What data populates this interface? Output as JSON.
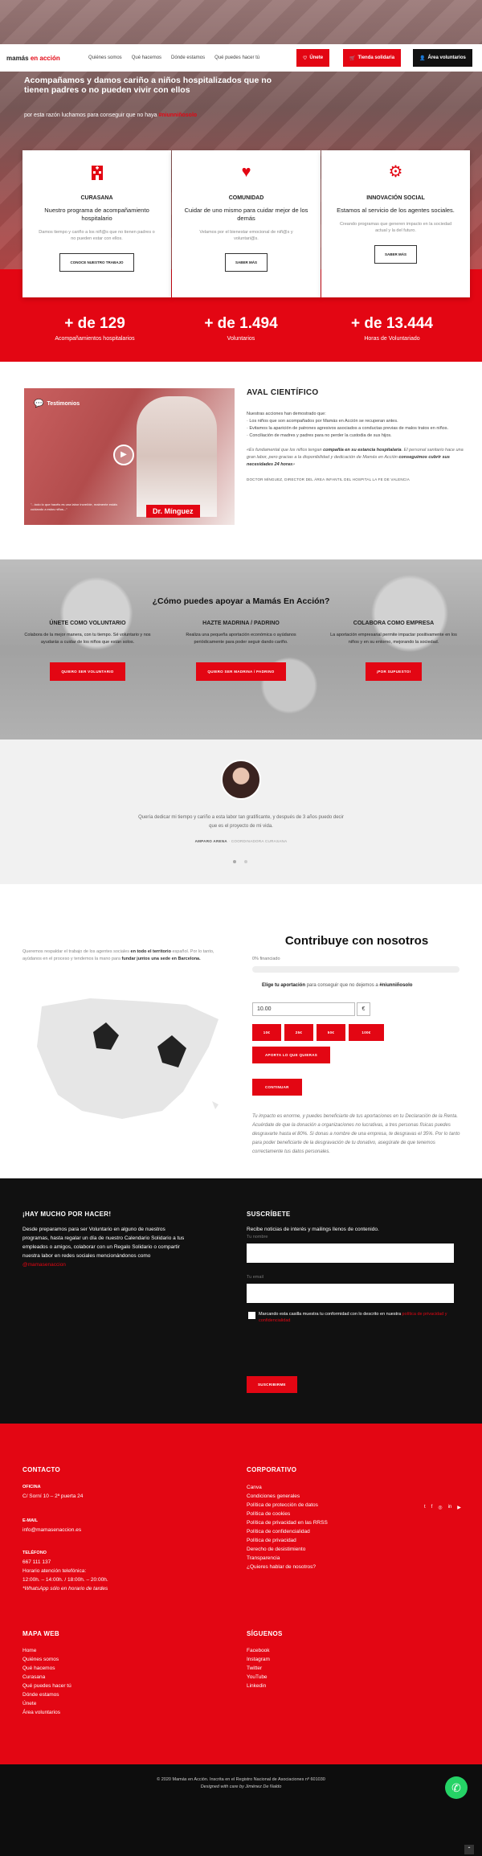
{
  "header": {
    "logo_a": "mamás",
    "logo_b": "en acción",
    "nav": [
      "Quiénes somos",
      "Qué hacemos",
      "Dónde estamos",
      "Qué puedes hacer tú"
    ],
    "btn_unete": "Únete",
    "btn_tienda": "Tienda solidaria",
    "btn_area": "Área voluntarios"
  },
  "hero": {
    "headline": "Acompañamos y damos cariño a niños hospitalizados que no tienen padres o no pueden vivir con ellos",
    "sub_a": "por esta razón luchamos para conseguir que no haya",
    "sub_b": "#niunniñosolo"
  },
  "cards": [
    {
      "title": "CURASANA",
      "sub": "Nuestro programa de acompañamiento hospitalario",
      "text": "Damos tiempo y cariño a los niñ@s que no tienen padres o no pueden estar con ellos.",
      "btn": "CONOCE NUESTRO TRABAJO"
    },
    {
      "title": "COMUNIDAD",
      "sub": "Cuidar de uno mismo para cuidar mejor de los demás",
      "text": "Velamos por el bienestar emocional de niñ@s y voluntari@s.",
      "btn": "SABER MÁS"
    },
    {
      "title": "INNOVACIÓN SOCIAL",
      "sub": "Estamos al servicio de los agentes sociales.",
      "text": "Creando programas que generen impacto en la sociedad actual y la del futuro.",
      "btn": "SABER MÁS"
    }
  ],
  "stats": [
    {
      "n": "+ de 129",
      "l": "Acompañamientos hospitalarios"
    },
    {
      "n": "+ de 1.494",
      "l": "Voluntarios"
    },
    {
      "n": "+ de 13.444",
      "l": "Horas de Voluntariado"
    }
  ],
  "video": {
    "label": "Testimonios",
    "name": "Dr. Mínguez",
    "caption": "\"...todo lo que hacéis es una labor increíble, realmente estáis cuidando a estos niños...\""
  },
  "aval": {
    "title": "AVAL CIENTÍFICO",
    "intro": "Nuestras acciones han demostrado que:",
    "bullets": [
      "· Los niños que son acompañados por Mamás en Acción se recuperan antes.",
      "· Evitamos la aparición de patrones agresivos asociados a conductas previas de malos tratos en niños.",
      "· Conciliación de madres y padres para no perder la custodia de sus hijos."
    ],
    "quote_a": "«Es fundamental que los niños tengan",
    "quote_b": "compañía en su estancia hospitalaria",
    "quote_c": ". El personal sanitario hace una gran labor, pero gracias a la disponibilidad y dedicación de Mamás en Acción",
    "quote_d": "conseguimos cubrir sus necesidades 24 horas",
    "quote_e": "»",
    "author": "DOCTOR MÍNGUEZ, DIRECTOR DEL ÁREA INFANTIL DEL HOSPITAL LA FE DE VALENCIA"
  },
  "apoyo": {
    "title": "¿Cómo puedes apoyar a Mamás En Acción?",
    "cols": [
      {
        "t": "ÚNETE COMO VOLUNTARIO",
        "p": "Colabora de la mejor manera, con tu tiempo. Sé voluntario y nos ayudarás a cuidar de los niños que están solos.",
        "b": "QUIERO SER VOLUNTARIO"
      },
      {
        "t": "HAZTE MADRINA / PADRINO",
        "p": "Realiza una pequeña aportación económica o ayúdanos periódicamente para poder seguir dando cariño.",
        "b": "QUIERO SER MADRINA / PADRINO"
      },
      {
        "t": "COLABORA COMO EMPRESA",
        "p": "La aportación empresarial permite impactar positivamente en los niños y en su entorno, mejorando la sociedad.",
        "b": "¡POR SUPUESTO!"
      }
    ]
  },
  "testimonial": {
    "quote_a": "Quería dedicar mi tiempo y cariño a esta labor tan gratificante, y después de 3 años puedo decir",
    "quote_b": "que es el proyecto de mi vida.",
    "author": "AMPARO ARENA",
    "role": "· COORDINADORA CURASANA"
  },
  "contrib": {
    "left_a": "Queremos respaldar el trabajo de los agentes sociales",
    "left_b": "en todo el territorio",
    "left_c": "español. Por lo tanto, ayúdanos en el proceso y tendemos la mano para",
    "left_d": "fundar juntos una sede en Barcelona.",
    "title": "Contribuye con nosotros",
    "pct": "0% financiado",
    "progress": 0,
    "elige_a": "Elige tu aportación",
    "elige_b": "para conseguir que no dejemos a",
    "elige_c": "#niunniñosolo",
    "amount": "10.00",
    "currency": "€",
    "chips": [
      "10€",
      "25€",
      "50€",
      "100€"
    ],
    "aporta": "APORTA LO QUE QUIERAS",
    "continuar": "CONTINUAR",
    "note": "Tu impacto es enorme, y puedes beneficiarte de tus aportaciones en tu Declaración de la Renta. Acuérdate de que la donación a organizaciones no lucrativas, a tres personas físicas puedes desgravarte hasta el 80%. Si donas a nombre de una empresa, te desgravas el 35%. Por lo tanto para poder beneficiarte de la desgravación de tu donativo, asegúrate de que tenemos correctamente tus datos personales."
  },
  "dark": {
    "h1": "¡HAY MUCHO POR HACER!",
    "p1": "Desde preparamos para ser Voluntario en alguno de nuestros programas, hasta regalar un día de nuestro Calendario Solidario a tus empleados o amigos, colaborar con un Regalo Solidario o compartir nuestra labor en redes sociales mencionándonos como",
    "p1_tag": "@mamasenaccion",
    "h2": "SUSCRÍBETE",
    "p2": "Recibe noticias de interés y mailings llenos de contenido.",
    "label_name": "Tu nombre",
    "label_email": "Tu email",
    "check_a": "Marcando esta casilla muestra tu conformidad con lo descrito en nuestra",
    "check_b": "política de privacidad y confidencialidad",
    "btn": "SUSCRIBIRME"
  },
  "contact": {
    "h": "CONTACTO",
    "oficina_h": "OFICINA",
    "oficina": "C/ Sorní 10 – 2ª puerta 24",
    "email_h": "E-MAIL",
    "email": "info@mamasenaccion.es",
    "tel_h": "TELÉFONO",
    "tel": "667 111 137",
    "hor1": "Horario atención telefónica:",
    "hor2": "12:00h. – 14:00h. / 18:00h. – 20:00h.",
    "hor3": "*WhatsApp sólo en horario de tardes"
  },
  "corporativo": {
    "h": "CORPORATIVO",
    "links": [
      "Canva",
      "Condiciones generales",
      "Política de protección de datos",
      "Política de cookies",
      "Política de privacidad en las RRSS",
      "Política de confidencialidad",
      "Política de privacidad",
      "Derecho de desistimiento",
      "Transparencia",
      "¿Quieres hablar de nosotros?"
    ]
  },
  "mapa": {
    "h": "MAPA WEB",
    "links": [
      "Home",
      "Quiénes somos",
      "Qué hacemos",
      "Curasana",
      "Qué puedes hacer tú",
      "Dónde estamos",
      "Únete",
      "Área voluntarios"
    ]
  },
  "siguenos": {
    "h": "SÍGUENOS",
    "links": [
      "Facebook",
      "Instagram",
      "Twitter",
      "YouTube",
      "Linkedin"
    ]
  },
  "social_icons": [
    "twitter-icon",
    "facebook-icon",
    "instagram-icon",
    "linkedin-icon",
    "youtube-icon"
  ],
  "bottom": {
    "line1": "© 2020 Mamás en Acción. Inscrita en el Registro Nacional de Asociaciones nº 601030",
    "line2": "Designed with care by Jiménez De Naldo"
  },
  "colors": {
    "accent": "#e30613",
    "dark": "#111111"
  }
}
